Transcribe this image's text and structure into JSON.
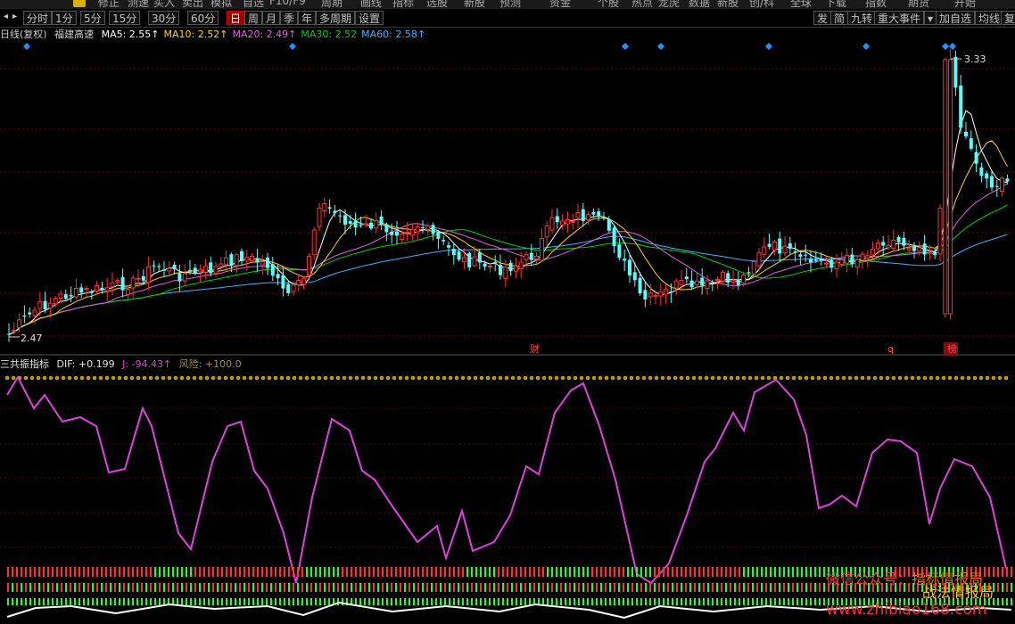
{
  "topbar": {
    "items": [
      "修正",
      "测速",
      "买入",
      "卖出",
      "模拟",
      "自选",
      "F10/F9",
      "周期",
      "画线",
      "指标",
      "选股",
      "新股",
      "预测",
      "资金",
      "个股",
      "热点",
      "龙虎",
      "数据",
      "新股",
      "创/科",
      "全球",
      "下载",
      "指数",
      "期货",
      "开始"
    ]
  },
  "periods": {
    "items": [
      "分时",
      "1分",
      "5分",
      "15分",
      "30分",
      "60分",
      "日",
      "周",
      "月",
      "季",
      "年",
      "多周期",
      "设置"
    ],
    "active": "日"
  },
  "right_buttons": [
    "发",
    "简",
    "九转",
    "重大事件",
    "加自选",
    "均线",
    "复权"
  ],
  "info": {
    "period": "日线(复权)",
    "stock": "福建高速",
    "ma": [
      {
        "label": "MA5: 2.55↑",
        "color": "#ffffff"
      },
      {
        "label": "MA10: 2.52↑",
        "color": "#ffd700"
      },
      {
        "label": "MA20: 2.49↑",
        "color": "#e060e0"
      },
      {
        "label": "MA30: 2.52",
        "color": "#00d000"
      },
      {
        "label": "MA60: 2.58↑",
        "color": "#40b0ff"
      }
    ]
  },
  "main_chart": {
    "price_high": 3.33,
    "price_low": 2.47,
    "high_label": "3.33",
    "low_label": "2.47",
    "markers": [
      "财",
      "q",
      "榜"
    ],
    "colors": {
      "up": "#ff3030",
      "down": "#54ffff",
      "ma5": "#ffffff",
      "ma10": "#ffd700",
      "ma20": "#e060e0",
      "ma30": "#00d000",
      "ma60": "#40b0ff",
      "grid": "#7a0000",
      "diamond": "#2090ff"
    }
  },
  "indicator": {
    "name": "三共振指标",
    "dif": "DIF: +0.199",
    "j": "J: -94.43↑",
    "risk": "风险: +100.0",
    "colors": {
      "j_line": "#e040e0",
      "risk_dots": "#b8a000",
      "red_bar": "#ff3030",
      "green_bar": "#20ff20",
      "white_line": "#ffffff"
    }
  },
  "watermark": {
    "line1_prefix": "微信公众号：",
    "line1_name": "指标情报局",
    "line2": "战法情报局",
    "url": "www.zhibiao168.com"
  }
}
